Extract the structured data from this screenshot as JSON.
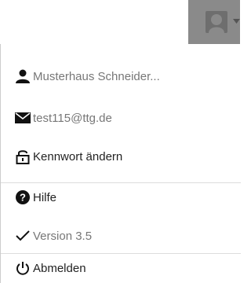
{
  "header": {
    "user_avatar_icon": "user-silhouette-icon",
    "toggle_caret_icon": "caret-down-icon",
    "toggle_bg_color": "#8a8a8a"
  },
  "menu": {
    "account_name": {
      "icon": "person-icon",
      "label": "Musterhaus Schneider..."
    },
    "email": {
      "icon": "envelope-icon",
      "label": "test115@ttg.de"
    },
    "change_password": {
      "icon": "unlock-icon",
      "label": "Kennwort ändern"
    },
    "help": {
      "icon": "question-circle-icon",
      "label": "Hilfe"
    },
    "version": {
      "icon": "checkmark-icon",
      "label": "Version 3.5"
    },
    "logout": {
      "icon": "power-icon",
      "label": "Abmelden"
    }
  }
}
